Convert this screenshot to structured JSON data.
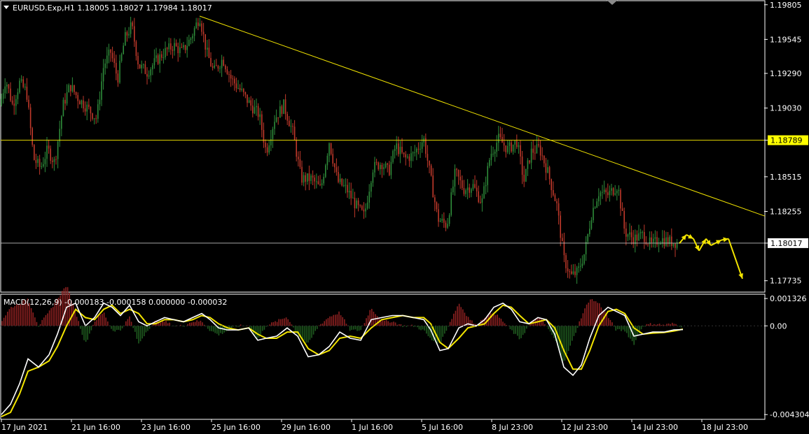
{
  "header": {
    "symbol_line": "EURUSD.Exp,H1  1.18005 1.18027 1.17984 1.18017"
  },
  "macd_header": "MACD(12,26,9) -0.000183 -0.000158 0.000000 -0.000032",
  "colors": {
    "background": "#000000",
    "bull": "#2e8b3a",
    "bear": "#c0392b",
    "line": "#f2e400",
    "macd_main": "#ffffff",
    "macd_signal": "#f2e400",
    "hist_pos": "#8b2020",
    "hist_neg": "#1f5a1f",
    "highlight_label": "#ffff00"
  },
  "chart_data": {
    "type": "candlestick",
    "price_axis_ticks": [
      "1.19805",
      "1.19545",
      "1.19290",
      "1.19030",
      "1.18789",
      "1.18515",
      "1.18255",
      "1.18017",
      "1.17735"
    ],
    "ylim": [
      1.1766,
      1.1983
    ],
    "highlight_levels": [
      {
        "value": 1.18789,
        "label": "1.18789",
        "style": "yellow"
      },
      {
        "value": 1.18017,
        "label": "1.18017",
        "style": "white"
      }
    ],
    "x_tick_labels": [
      "17 Jun 2021",
      "21 Jun 16:00",
      "23 Jun 16:00",
      "25 Jun 16:00",
      "29 Jun 16:00",
      "1 Jul 16:00",
      "5 Jul 16:00",
      "8 Jul 23:00",
      "12 Jul 23:00",
      "14 Jul 23:00",
      "18 Jul 23:00"
    ],
    "price_path": [
      [
        0,
        1.1905
      ],
      [
        8,
        1.1925
      ],
      [
        18,
        1.1905
      ],
      [
        28,
        1.1922
      ],
      [
        38,
        1.1915
      ],
      [
        48,
        1.1865
      ],
      [
        58,
        1.1858
      ],
      [
        68,
        1.1872
      ],
      [
        78,
        1.1862
      ],
      [
        90,
        1.1905
      ],
      [
        100,
        1.192
      ],
      [
        112,
        1.191
      ],
      [
        125,
        1.1903
      ],
      [
        138,
        1.1895
      ],
      [
        148,
        1.1935
      ],
      [
        158,
        1.1945
      ],
      [
        168,
        1.1925
      ],
      [
        178,
        1.1955
      ],
      [
        188,
        1.1965
      ],
      [
        198,
        1.1935
      ],
      [
        210,
        1.193
      ],
      [
        222,
        1.1938
      ],
      [
        235,
        1.1945
      ],
      [
        248,
        1.195
      ],
      [
        260,
        1.1945
      ],
      [
        272,
        1.1955
      ],
      [
        285,
        1.1972
      ],
      [
        295,
        1.1945
      ],
      [
        305,
        1.193
      ],
      [
        318,
        1.194
      ],
      [
        330,
        1.1925
      ],
      [
        345,
        1.1915
      ],
      [
        358,
        1.1905
      ],
      [
        370,
        1.1898
      ],
      [
        380,
        1.187
      ],
      [
        392,
        1.1895
      ],
      [
        405,
        1.1905
      ],
      [
        418,
        1.1885
      ],
      [
        430,
        1.185
      ],
      [
        445,
        1.185
      ],
      [
        458,
        1.1842
      ],
      [
        470,
        1.1878
      ],
      [
        482,
        1.1848
      ],
      [
        495,
        1.1842
      ],
      [
        508,
        1.183
      ],
      [
        520,
        1.1822
      ],
      [
        532,
        1.1858
      ],
      [
        545,
        1.1862
      ],
      [
        555,
        1.1855
      ],
      [
        565,
        1.1875
      ],
      [
        578,
        1.1865
      ],
      [
        590,
        1.1868
      ],
      [
        605,
        1.188
      ],
      [
        615,
        1.185
      ],
      [
        625,
        1.182
      ],
      [
        638,
        1.1815
      ],
      [
        650,
        1.1855
      ],
      [
        662,
        1.1842
      ],
      [
        675,
        1.1845
      ],
      [
        688,
        1.1832
      ],
      [
        700,
        1.1868
      ],
      [
        712,
        1.188
      ],
      [
        725,
        1.1872
      ],
      [
        738,
        1.1878
      ],
      [
        748,
        1.1848
      ],
      [
        758,
        1.187
      ],
      [
        770,
        1.1873
      ],
      [
        782,
        1.1855
      ],
      [
        795,
        1.183
      ],
      [
        805,
        1.179
      ],
      [
        815,
        1.1777
      ],
      [
        825,
        1.178
      ],
      [
        835,
        1.1795
      ],
      [
        845,
        1.1825
      ],
      [
        855,
        1.184
      ],
      [
        868,
        1.1838
      ],
      [
        882,
        1.1845
      ],
      [
        892,
        1.181
      ],
      [
        905,
        1.1805
      ],
      [
        918,
        1.1808
      ],
      [
        930,
        1.18
      ],
      [
        942,
        1.1805
      ],
      [
        955,
        1.1803
      ],
      [
        968,
        1.1802
      ]
    ],
    "forecast_arrows": [
      [
        970,
        1.18015
      ],
      [
        980,
        1.1808
      ],
      [
        990,
        1.1805
      ],
      [
        998,
        1.1796
      ],
      [
        1008,
        1.1805
      ],
      [
        1015,
        1.18
      ],
      [
        1030,
        1.1804
      ],
      [
        1040,
        1.1805
      ],
      [
        1060,
        1.1775
      ]
    ],
    "trendline": {
      "from": [
        285,
        1.1972
      ],
      "to": [
        1092,
        1.1822
      ]
    },
    "macd": {
      "ticks": [
        "0.001326",
        "0.00",
        "-0.004304"
      ],
      "ylim": [
        -0.0045,
        0.0015
      ],
      "main": [
        [
          2,
          -0.0043
        ],
        [
          15,
          -0.0038
        ],
        [
          28,
          -0.0028
        ],
        [
          40,
          -0.0016
        ],
        [
          55,
          -0.002
        ],
        [
          70,
          -0.0014
        ],
        [
          82,
          -0.0004
        ],
        [
          95,
          0.0009
        ],
        [
          108,
          0.0011
        ],
        [
          122,
          0.0
        ],
        [
          135,
          0.0004
        ],
        [
          148,
          0.0011
        ],
        [
          160,
          0.0009
        ],
        [
          172,
          0.0005
        ],
        [
          185,
          0.001
        ],
        [
          198,
          0.0002
        ],
        [
          210,
          0.0
        ],
        [
          222,
          0.0002
        ],
        [
          235,
          0.0004
        ],
        [
          248,
          0.0003
        ],
        [
          262,
          0.0002
        ],
        [
          275,
          0.0004
        ],
        [
          288,
          0.0006
        ],
        [
          300,
          0.0003
        ],
        [
          312,
          -0.0001
        ],
        [
          325,
          -0.0002
        ],
        [
          340,
          -0.0002
        ],
        [
          355,
          -0.0001
        ],
        [
          368,
          -0.0007
        ],
        [
          380,
          -0.0006
        ],
        [
          395,
          -0.0005
        ],
        [
          410,
          -0.0001
        ],
        [
          425,
          -0.0005
        ],
        [
          440,
          -0.0015
        ],
        [
          455,
          -0.0014
        ],
        [
          470,
          -0.001
        ],
        [
          485,
          -0.0003
        ],
        [
          500,
          -0.0006
        ],
        [
          515,
          -0.0007
        ],
        [
          530,
          0.0003
        ],
        [
          545,
          0.0004
        ],
        [
          560,
          0.0005
        ],
        [
          575,
          0.0005
        ],
        [
          590,
          0.0004
        ],
        [
          605,
          0.0003
        ],
        [
          615,
          -0.0002
        ],
        [
          628,
          -0.0012
        ],
        [
          640,
          -0.0011
        ],
        [
          655,
          -0.0001
        ],
        [
          668,
          0.0001
        ],
        [
          680,
          0.0
        ],
        [
          692,
          0.0003
        ],
        [
          705,
          0.0009
        ],
        [
          718,
          0.0011
        ],
        [
          730,
          0.0008
        ],
        [
          742,
          0.0002
        ],
        [
          755,
          0.0001
        ],
        [
          768,
          0.0004
        ],
        [
          780,
          0.0003
        ],
        [
          792,
          -0.0004
        ],
        [
          805,
          -0.002
        ],
        [
          818,
          -0.0024
        ],
        [
          830,
          -0.0019
        ],
        [
          842,
          -0.0006
        ],
        [
          855,
          0.0005
        ],
        [
          868,
          0.0009
        ],
        [
          880,
          0.0007
        ],
        [
          892,
          0.0005
        ],
        [
          905,
          -0.0005
        ],
        [
          918,
          -0.0004
        ],
        [
          932,
          -0.0003
        ],
        [
          948,
          -0.0003
        ],
        [
          962,
          -0.0002
        ],
        [
          975,
          -0.00018
        ]
      ],
      "signal": [
        [
          2,
          -0.0044
        ],
        [
          15,
          -0.0042
        ],
        [
          28,
          -0.0033
        ],
        [
          40,
          -0.0022
        ],
        [
          55,
          -0.002
        ],
        [
          70,
          -0.0017
        ],
        [
          82,
          -0.001
        ],
        [
          95,
          0.0
        ],
        [
          108,
          0.0008
        ],
        [
          122,
          0.0004
        ],
        [
          135,
          0.0003
        ],
        [
          148,
          0.0008
        ],
        [
          160,
          0.001
        ],
        [
          172,
          0.0006
        ],
        [
          185,
          0.0008
        ],
        [
          198,
          0.0006
        ],
        [
          210,
          0.0001
        ],
        [
          222,
          0.0001
        ],
        [
          235,
          0.0003
        ],
        [
          248,
          0.0003
        ],
        [
          262,
          0.0002
        ],
        [
          275,
          0.0003
        ],
        [
          288,
          0.0005
        ],
        [
          300,
          0.0004
        ],
        [
          312,
          0.0001
        ],
        [
          325,
          -0.0001
        ],
        [
          340,
          -0.0002
        ],
        [
          355,
          -0.0001
        ],
        [
          368,
          -0.0004
        ],
        [
          380,
          -0.0006
        ],
        [
          395,
          -0.0006
        ],
        [
          410,
          -0.0003
        ],
        [
          425,
          -0.0003
        ],
        [
          440,
          -0.0011
        ],
        [
          455,
          -0.0014
        ],
        [
          470,
          -0.0012
        ],
        [
          485,
          -0.0006
        ],
        [
          500,
          -0.0005
        ],
        [
          515,
          -0.0006
        ],
        [
          530,
          -0.0001
        ],
        [
          545,
          0.0003
        ],
        [
          560,
          0.0004
        ],
        [
          575,
          0.0005
        ],
        [
          590,
          0.0004
        ],
        [
          605,
          0.0004
        ],
        [
          615,
          0.0001
        ],
        [
          628,
          -0.0008
        ],
        [
          640,
          -0.0011
        ],
        [
          655,
          -0.0006
        ],
        [
          668,
          -0.0001
        ],
        [
          680,
          0.0
        ],
        [
          692,
          0.0001
        ],
        [
          705,
          0.0006
        ],
        [
          718,
          0.001
        ],
        [
          730,
          0.0009
        ],
        [
          742,
          0.0005
        ],
        [
          755,
          0.0001
        ],
        [
          768,
          0.0002
        ],
        [
          780,
          0.0003
        ],
        [
          792,
          -0.0001
        ],
        [
          805,
          -0.0012
        ],
        [
          818,
          -0.0021
        ],
        [
          830,
          -0.0021
        ],
        [
          842,
          -0.0012
        ],
        [
          855,
          0.0
        ],
        [
          868,
          0.0007
        ],
        [
          880,
          0.0008
        ],
        [
          892,
          0.0006
        ],
        [
          905,
          -0.0001
        ],
        [
          918,
          -0.0004
        ],
        [
          932,
          -0.00035
        ],
        [
          948,
          -0.00032
        ],
        [
          962,
          -0.00025
        ],
        [
          975,
          -0.00016
        ]
      ]
    }
  }
}
